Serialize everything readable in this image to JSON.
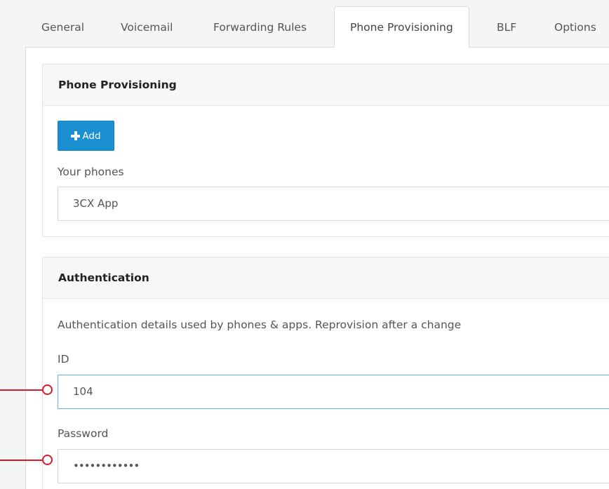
{
  "tabs": [
    {
      "label": "General",
      "active": false
    },
    {
      "label": "Voicemail",
      "active": false
    },
    {
      "label": "Forwarding Rules",
      "active": false
    },
    {
      "label": "Phone Provisioning",
      "active": true
    },
    {
      "label": "BLF",
      "active": false
    },
    {
      "label": "Options",
      "active": false
    }
  ],
  "provisioning": {
    "title": "Phone Provisioning",
    "add_label": "Add",
    "your_phones_label": "Your phones",
    "phone_value": "3CX App"
  },
  "authentication": {
    "title": "Authentication",
    "description": "Authentication details used by phones & apps. Reprovision after a change",
    "id_label": "ID",
    "id_value": "104",
    "password_label": "Password",
    "password_value": "••••••••••••"
  },
  "colors": {
    "accent": "#1a8fd1",
    "callout": "#d21f2b",
    "focus_border": "#66afe9"
  }
}
